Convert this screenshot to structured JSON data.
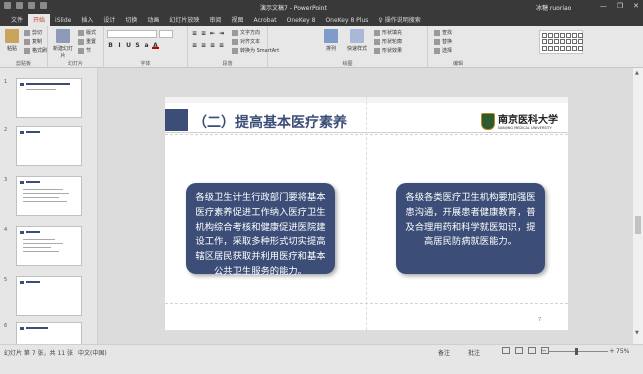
{
  "window": {
    "title": "演示文稿7 - PowerPoint",
    "user": "冰糖 ruoriao",
    "controls": [
      "—",
      "❐",
      "✕"
    ]
  },
  "tabs": [
    {
      "label": "文件",
      "active": false
    },
    {
      "label": "开始",
      "active": true
    },
    {
      "label": "iSlide",
      "active": false
    },
    {
      "label": "插入",
      "active": false
    },
    {
      "label": "设计",
      "active": false
    },
    {
      "label": "切换",
      "active": false
    },
    {
      "label": "动画",
      "active": false
    },
    {
      "label": "幻灯片放映",
      "active": false
    },
    {
      "label": "审阅",
      "active": false
    },
    {
      "label": "视图",
      "active": false
    },
    {
      "label": "Acrobat",
      "active": false
    },
    {
      "label": "OneKey 8",
      "active": false
    },
    {
      "label": "OneKey 8 Plus",
      "active": false
    }
  ],
  "tell_me": "操作说明搜索",
  "ribbon": {
    "clipboard": {
      "paste": "粘贴",
      "cut": "剪切",
      "copy": "复制",
      "format": "格式刷",
      "label": "剪贴板"
    },
    "slides": {
      "new_slide": "新建幻灯片",
      "layout": "版式",
      "reset": "重置",
      "section": "节",
      "label": "幻灯片"
    },
    "font": {
      "label": "字体"
    },
    "paragraph": {
      "label": "段落"
    },
    "text_direction": "文字方向",
    "align_text": "对齐文本",
    "smartart": "转换为 SmartArt",
    "drawing": {
      "arrange": "排列",
      "quick_styles": "快速样式",
      "label": "绘图"
    },
    "shape_fill": "形状填充",
    "shape_outline": "形状轮廓",
    "shape_effects": "形状效果",
    "editing": {
      "find": "查找",
      "replace": "替换",
      "select": "选择",
      "label": "编辑"
    }
  },
  "slide": {
    "title": "（二）提高基本医疗素养",
    "logo_cn": "南京医科大学",
    "logo_en": "NANJING MEDICAL UNIVERSITY",
    "card_left": "各级卫生计生行政部门要将基本医疗素养促进工作纳入医疗卫生机构综合考核和健康促进医院建设工作，采取多种形式切实提高辖区居民获取并利用医疗和基本公共卫生服务的能力。",
    "card_right": "各级各类医疗卫生机构要加强医患沟通，开展患者健康教育，普及合理用药和科学就医知识，提高居民防病就医能力。",
    "page_number": "7",
    "colors": {
      "accent": "#3c4e78",
      "background": "#ffffff"
    }
  },
  "thumbnails": [
    {
      "number": "1"
    },
    {
      "number": "2"
    },
    {
      "number": "3"
    },
    {
      "number": "4"
    },
    {
      "number": "5"
    },
    {
      "number": "6"
    }
  ],
  "status": {
    "slide_info": "幻灯片 第 7 张，共 11 张",
    "language": "中文(中国)",
    "notes": "备注",
    "comments": "批注",
    "zoom": "75%"
  }
}
